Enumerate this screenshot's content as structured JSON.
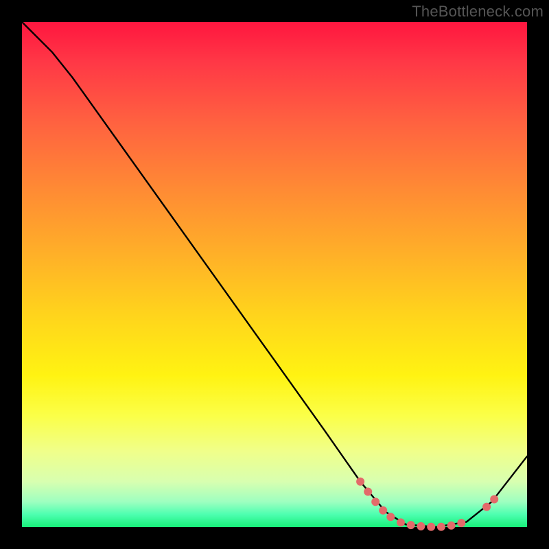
{
  "watermark": "TheBottleneck.com",
  "chart_data": {
    "type": "line",
    "title": "",
    "xlabel": "",
    "ylabel": "",
    "xlim": [
      0,
      100
    ],
    "ylim": [
      0,
      100
    ],
    "curve": {
      "name": "bottleneck-curve",
      "points": [
        {
          "x": 0,
          "y": 100
        },
        {
          "x": 6,
          "y": 94
        },
        {
          "x": 10,
          "y": 89
        },
        {
          "x": 20,
          "y": 75
        },
        {
          "x": 30,
          "y": 61
        },
        {
          "x": 40,
          "y": 47
        },
        {
          "x": 50,
          "y": 33
        },
        {
          "x": 60,
          "y": 19
        },
        {
          "x": 67,
          "y": 9
        },
        {
          "x": 72,
          "y": 3
        },
        {
          "x": 76,
          "y": 0.5
        },
        {
          "x": 82,
          "y": 0
        },
        {
          "x": 88,
          "y": 1
        },
        {
          "x": 93,
          "y": 5
        },
        {
          "x": 100,
          "y": 14
        }
      ]
    },
    "markers": {
      "name": "highlight-dots",
      "color": "#e36a6a",
      "points": [
        {
          "x": 67,
          "y": 9
        },
        {
          "x": 68.5,
          "y": 7
        },
        {
          "x": 70,
          "y": 5
        },
        {
          "x": 71.5,
          "y": 3.3
        },
        {
          "x": 73,
          "y": 2
        },
        {
          "x": 75,
          "y": 0.9
        },
        {
          "x": 77,
          "y": 0.4
        },
        {
          "x": 79,
          "y": 0.15
        },
        {
          "x": 81,
          "y": 0.05
        },
        {
          "x": 83,
          "y": 0.05
        },
        {
          "x": 85,
          "y": 0.3
        },
        {
          "x": 87,
          "y": 0.8
        },
        {
          "x": 92,
          "y": 4
        },
        {
          "x": 93.5,
          "y": 5.5
        }
      ]
    },
    "gradient_stops": [
      {
        "pos": 0,
        "color": "#ff163f"
      },
      {
        "pos": 0.5,
        "color": "#ffd41c"
      },
      {
        "pos": 0.78,
        "color": "#fbff48"
      },
      {
        "pos": 1.0,
        "color": "#18f07a"
      }
    ]
  }
}
